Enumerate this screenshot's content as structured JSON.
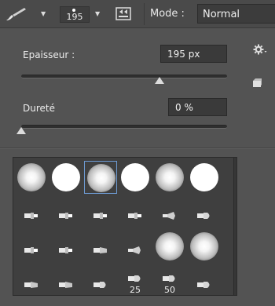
{
  "toolbar": {
    "tool_icon": "brush-icon",
    "brush_size": "195",
    "brush_panel_icon": "brush-panel-toggle-icon",
    "mode_label": "Mode :",
    "mode_value": "Normal"
  },
  "settings": {
    "epaisseur_label": "Epaisseur :",
    "epaisseur_value": "195 px",
    "epaisseur_slider": 0.67,
    "durete_label": "Dureté",
    "durete_value": "0 %",
    "durete_slider": 0.0,
    "gear_icon": "gear-icon",
    "new_preset_icon": "new-preset-icon"
  },
  "presets": {
    "rows": [
      [
        "soft-round",
        "hard-round",
        "soft-round",
        "hard-round",
        "soft-round",
        "hard-round"
      ],
      [
        "flat-brush",
        "flat-brush",
        "flat-brush",
        "flat-brush",
        "fan-brush",
        "round-brush"
      ],
      [
        "flat-brush",
        "flat-brush",
        "angle-brush",
        "fan-brush",
        "soft-round",
        "soft-round"
      ],
      [
        "angle-brush",
        "angle-brush",
        "round-brush",
        "round-brush",
        "round-brush",
        "round-brush"
      ]
    ],
    "selected_index": 2,
    "cell_numbers": {
      "21": "25",
      "22": "50"
    }
  }
}
